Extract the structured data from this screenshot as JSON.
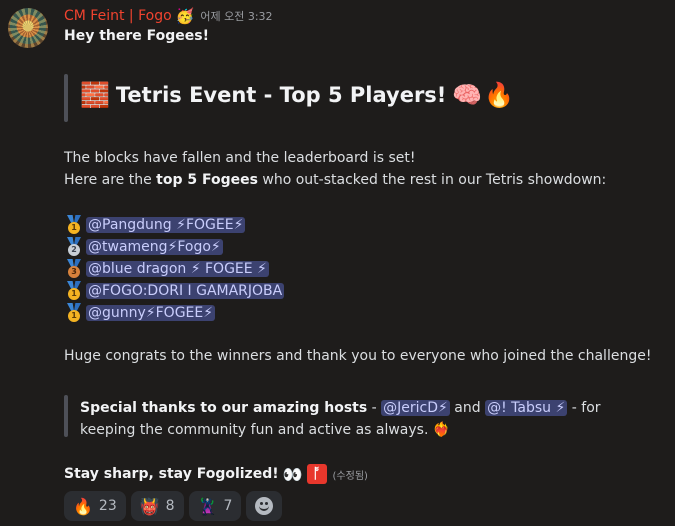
{
  "message": {
    "author": "CM Feint | Fogo",
    "author_badge": "🥳",
    "timestamp": "어제 오전 3:32",
    "greeting": "Hey there Fogees!",
    "event_title": "Tetris Event - Top 5 Players!",
    "event_title_icons": [
      "brick-icon",
      "brain-icon",
      "fire-icon"
    ],
    "intro_line1": "The blocks have fallen and the leaderboard is set!",
    "intro_line2_pre": "Here are the ",
    "intro_line2_bold": "top 5 Fogees",
    "intro_line2_post": " who out-stacked the rest in our Tetris showdown:",
    "leaderboard": [
      {
        "rank": "1",
        "medal": "gold",
        "mention": "@Pangdung ⚡FOGEE⚡"
      },
      {
        "rank": "2",
        "medal": "silver",
        "mention": "@twameng⚡Fogo⚡"
      },
      {
        "rank": "3",
        "medal": "bronze",
        "mention": "@blue dragon ⚡ FOGEE ⚡"
      },
      {
        "rank": "1",
        "medal": "gold",
        "mention": "@FOGO:DORI I GAMARJOBA"
      },
      {
        "rank": "1",
        "medal": "gold",
        "mention": "@gunny⚡FOGEE⚡"
      }
    ],
    "congrats": "Huge congrats to the winners and thank you to everyone who joined the challenge!",
    "thanks_bold": "Special thanks to our amazing hosts",
    "thanks_dash1": " - ",
    "host1": "@JericD⚡",
    "thanks_and": " and ",
    "host2": "@! Tabsu ⚡",
    "thanks_rest": " - for keeping the community fun and active as always.",
    "stay_sharp": "Stay sharp, stay Fogolized!",
    "stay_icons": [
      "eyes-icon",
      "fogo-logo-icon"
    ],
    "fogo_logo_char": "ᚩ",
    "edited": "(수정됨)"
  },
  "reactions": [
    {
      "emoji": "🔥",
      "count": "23",
      "icon": "fire-icon"
    },
    {
      "emoji": "👹",
      "count": "8",
      "icon": "ogre-icon"
    },
    {
      "emoji": "🦹",
      "count": "7",
      "icon": "masked-character-icon"
    }
  ],
  "colors": {
    "background": "#1e1c1b",
    "username": "#f0432f",
    "mention_bg": "#3c4270",
    "mention_text": "#c9cdfb"
  }
}
